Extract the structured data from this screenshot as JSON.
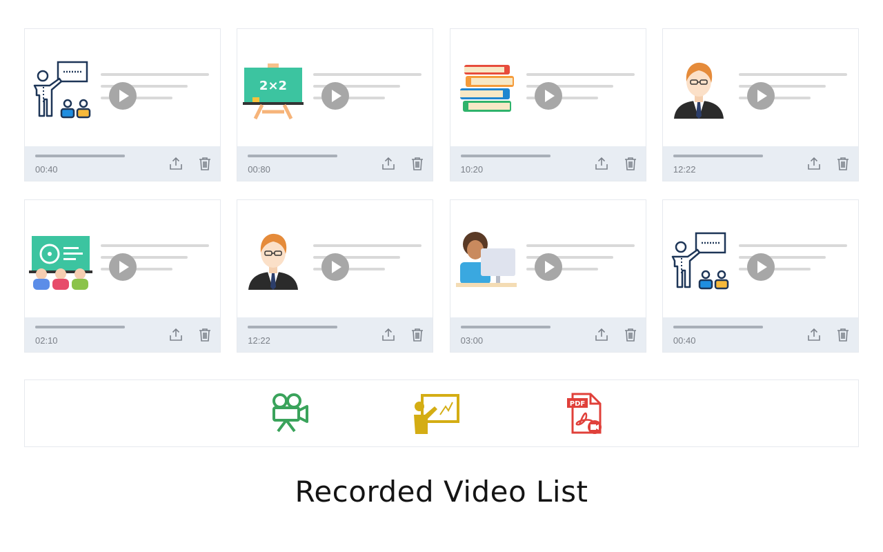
{
  "page": {
    "title": "Recorded Video List"
  },
  "videos": [
    {
      "thumbnail": "teacher-presenting-icon",
      "duration": "00:40"
    },
    {
      "thumbnail": "chalkboard-math-icon",
      "duration": "00:80"
    },
    {
      "thumbnail": "book-stack-icon",
      "duration": "10:20"
    },
    {
      "thumbnail": "teacher-avatar-icon",
      "duration": "12:22"
    },
    {
      "thumbnail": "classroom-board-icon",
      "duration": "02:10"
    },
    {
      "thumbnail": "teacher-avatar-icon",
      "duration": "12:22"
    },
    {
      "thumbnail": "student-computer-icon",
      "duration": "03:00"
    },
    {
      "thumbnail": "teacher-presenting-icon",
      "duration": "00:40"
    }
  ],
  "toolbar": {
    "items": [
      {
        "name": "video-camera-icon",
        "color": "#3aa35b"
      },
      {
        "name": "presentation-board-icon",
        "color": "#d4ad14"
      },
      {
        "name": "pdf-file-icon",
        "color": "#e0403a"
      }
    ]
  },
  "colors": {
    "card_footer": "#e8edf3",
    "play_button": "#a7a7a7",
    "placeholder_line": "#d9d9d9"
  }
}
